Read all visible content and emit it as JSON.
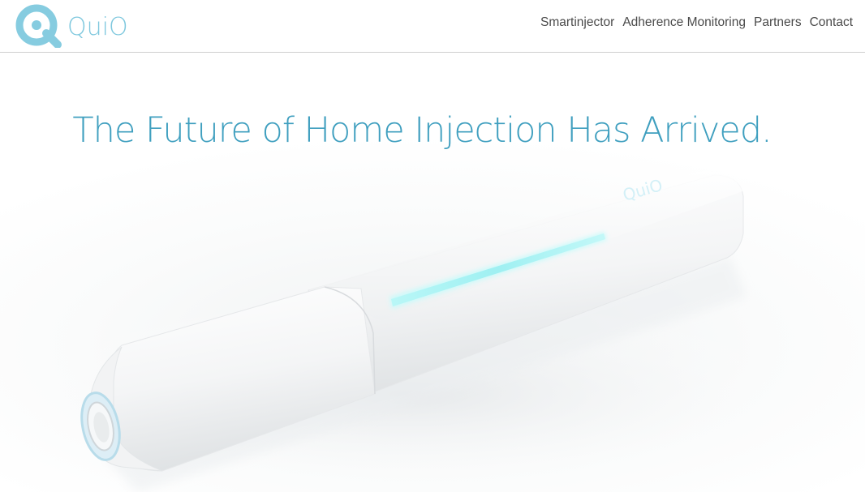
{
  "brand": {
    "name": "QuiO",
    "accent": "#7fc8de",
    "title_color": "#3f9fbf"
  },
  "nav": {
    "items": [
      {
        "label": "Smartinjector"
      },
      {
        "label": "Adherence Monitoring"
      },
      {
        "label": "Partners"
      },
      {
        "label": "Contact"
      }
    ]
  },
  "hero": {
    "headline": "The Future of Home Injection Has Arrived.",
    "device_icon": "smartinjector-device-image",
    "device_brand_mark": "QuiO"
  }
}
